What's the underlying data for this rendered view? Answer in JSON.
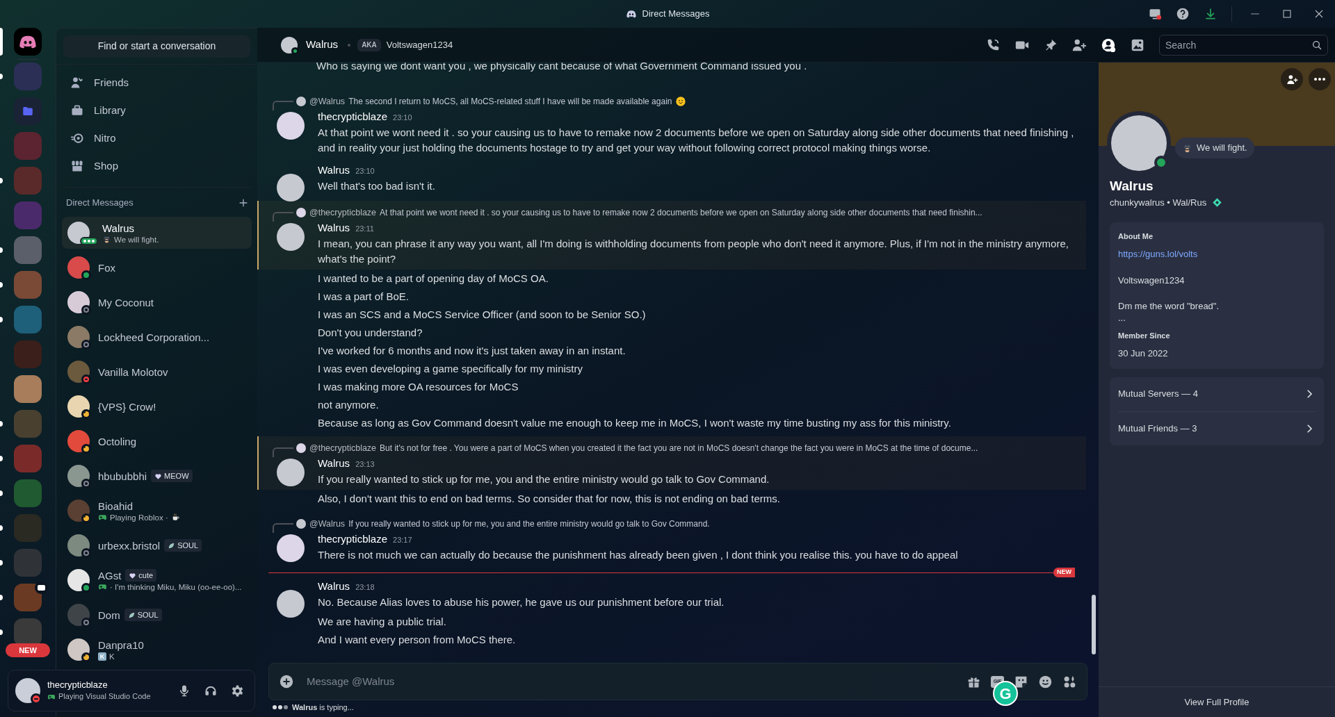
{
  "title_bar": {
    "title": "Direct Messages"
  },
  "servers": [
    {
      "kind": "home",
      "selected": true,
      "unread": false,
      "streaming": false
    },
    {
      "kind": "server",
      "selected": false,
      "unread": true,
      "streaming": false
    },
    {
      "kind": "folder",
      "selected": false,
      "unread": false,
      "streaming": false
    },
    {
      "kind": "server",
      "selected": false,
      "unread": false,
      "streaming": false
    },
    {
      "kind": "server",
      "selected": false,
      "unread": true,
      "streaming": false
    },
    {
      "kind": "server",
      "selected": false,
      "unread": false,
      "streaming": false
    },
    {
      "kind": "server",
      "selected": false,
      "unread": true,
      "streaming": false
    },
    {
      "kind": "server",
      "selected": false,
      "unread": true,
      "streaming": false
    },
    {
      "kind": "server",
      "selected": false,
      "unread": true,
      "streaming": false
    },
    {
      "kind": "server",
      "selected": false,
      "unread": false,
      "streaming": false
    },
    {
      "kind": "server",
      "selected": false,
      "unread": false,
      "streaming": false
    },
    {
      "kind": "server",
      "selected": false,
      "unread": true,
      "streaming": false
    },
    {
      "kind": "server",
      "selected": false,
      "unread": true,
      "streaming": false
    },
    {
      "kind": "server",
      "selected": false,
      "unread": true,
      "streaming": false
    },
    {
      "kind": "server",
      "selected": false,
      "unread": true,
      "streaming": false
    },
    {
      "kind": "server",
      "selected": false,
      "unread": true,
      "streaming": false
    },
    {
      "kind": "server",
      "selected": false,
      "unread": true,
      "streaming": true
    },
    {
      "kind": "server",
      "selected": false,
      "unread": true,
      "streaming": false
    }
  ],
  "new_badge": "NEW",
  "sidebar": {
    "search": "Find or start a conversation",
    "nav": [
      {
        "kind": "friends",
        "label": "Friends"
      },
      {
        "kind": "library",
        "label": "Library"
      },
      {
        "kind": "nitro",
        "label": "Nitro"
      },
      {
        "kind": "shop",
        "label": "Shop"
      }
    ],
    "dm_heading": "Direct Messages",
    "dms": [
      {
        "name": "Walrus",
        "color": "#23a55a",
        "selected": true,
        "typing": true,
        "activity": {
          "kind": "custom",
          "text": "We will fight."
        }
      },
      {
        "name": "Fox",
        "color": "#23a55a",
        "selected": false,
        "typing": false
      },
      {
        "name": "My Coconut",
        "color": "#80848e",
        "selected": false,
        "typing": false
      },
      {
        "name": "Lockheed Corporation...",
        "color": "#80848e",
        "selected": false,
        "typing": false
      },
      {
        "name": "Vanilla Molotov",
        "color": "#f23f43",
        "selected": false,
        "typing": false
      },
      {
        "name": "{VPS} Crow!",
        "color": "#f0b232",
        "selected": false,
        "typing": false
      },
      {
        "name": "Octoling",
        "color": "#f0b232",
        "selected": false,
        "typing": false
      },
      {
        "name": "hbububbhi",
        "color": "#80848e",
        "selected": false,
        "typing": false,
        "tag": {
          "kind": "heart",
          "label": "MEOW"
        }
      },
      {
        "name": "Bioahid",
        "color": "#f0b232",
        "selected": false,
        "typing": false,
        "activity": {
          "kind": "game_emoji",
          "text": "Playing Roblox ·"
        }
      },
      {
        "name": "urbexx.bristol",
        "color": "#80848e",
        "selected": false,
        "typing": false,
        "tag": {
          "kind": "leaf",
          "label": "SOUL"
        }
      },
      {
        "name": "AGst",
        "color": "#23a55a",
        "selected": false,
        "typing": false,
        "tag": {
          "kind": "heart",
          "label": "cute"
        },
        "activity": {
          "kind": "game",
          "text": "· I'm thinking Miku, Miku (oo-ee-oo)..."
        }
      },
      {
        "name": "Dom",
        "color": "#80848e",
        "selected": false,
        "typing": false,
        "tag": {
          "kind": "leaf",
          "label": "SOUL"
        }
      },
      {
        "name": "Danpra10",
        "color": "#f0b232",
        "selected": false,
        "typing": false,
        "activity": {
          "kind": "tile",
          "tile": "K",
          "text": "K"
        }
      }
    ]
  },
  "user_panel": {
    "name": "thecrypticblaze",
    "activity": "Playing Visual Studio Code",
    "color": "#f23f43"
  },
  "header": {
    "name": "Walrus",
    "color": "#23a55a",
    "aka": "AKA",
    "alias": "Voltswagen1234",
    "search": {
      "placeholder": "Search"
    }
  },
  "messages": [
    {
      "kind": "continuation",
      "lines": [
        "Who is saying we dont want you , we physically cant because of what Government Command issued you ."
      ]
    },
    {
      "kind": "message",
      "author": "thecrypticblaze",
      "time": "23:10",
      "mentioned": false,
      "reply": {
        "author": "@Walrus",
        "text": "The second I return to MoCS, all MoCS-related stuff I have will be made available again",
        "emoji": true
      },
      "lines": [
        "At that point we wont need it . so your causing us to have to remake now 2 documents before we open on Saturday along side other documents that need finishing , and in reality your just holding the documents hostage to try and get your way without following correct protocol making things worse."
      ]
    },
    {
      "kind": "message",
      "author": "Walrus",
      "time": "23:10",
      "mentioned": false,
      "lines": [
        "Well that's too bad isn't it."
      ]
    },
    {
      "kind": "message",
      "author": "Walrus",
      "time": "23:11",
      "mentioned": true,
      "reply": {
        "author": "@thecrypticblaze",
        "text": "At that point we wont need it . so your causing us to have to remake now 2 documents before we open on Saturday along side other documents that need finishin..."
      },
      "lines": [
        "I mean, you can phrase it any way you want, all I'm doing is withholding documents from people who don't need it anymore. Plus, if I'm not in the ministry anymore, what's the point?",
        "I wanted to be a part of opening day of MoCS OA.",
        "I was a part of BoE.",
        "I was an SCS and a MoCS Service Officer (and soon to be Senior SO.)",
        "Don't you understand?",
        "I've worked for 6 months and now it's just taken away in an instant.",
        "I was even developing a game specifically for my ministry",
        "I was making more OA resources for MoCS",
        "not anymore.",
        "Because as long as Gov Command doesn't value me enough to keep me in MoCS, I won't waste my time busting my ass for this ministry."
      ]
    },
    {
      "kind": "message",
      "author": "Walrus",
      "time": "23:13",
      "mentioned": true,
      "reply": {
        "author": "@thecrypticblaze",
        "text": "But it's not for free . You were a part of MoCS when you created it the fact you are not in MoCS doesn't change the fact you were in MoCS at the time of docume..."
      },
      "lines": [
        "If you really wanted to stick up for me, you and the entire ministry would go talk to Gov Command.",
        "Also, I don't want this to end on bad terms. So consider that for now, this is not ending on bad terms."
      ]
    },
    {
      "kind": "message",
      "author": "thecrypticblaze",
      "time": "23:17",
      "mentioned": false,
      "reply": {
        "author": "@Walrus",
        "text": "If you really wanted to stick up for me, you and the entire ministry would go talk to Gov Command."
      },
      "lines": [
        "There is not much we can actually do because the punishment has already been given , I dont think you realise this. you have to do appeal"
      ]
    },
    {
      "kind": "divider",
      "label": "NEW"
    },
    {
      "kind": "message",
      "author": "Walrus",
      "time": "23:18",
      "mentioned": false,
      "lines": [
        "No. Because Alias loves to abuse his power, he gave us our punishment before our trial.",
        "We are having a public trial.",
        "And I want every person from MoCS there."
      ]
    }
  ],
  "composer": {
    "placeholder": "Message @Walrus",
    "gif": "GIF",
    "overlay_badge": "G"
  },
  "typing": "**Walrus** is typing...",
  "profile": {
    "color": "#23a55a",
    "status_text": "We will fight.",
    "name": "Walrus",
    "handle": "chunkywalrus • Wal/Rus",
    "about_heading": "About Me",
    "about_link": "https://guns.lol/volts",
    "about_lines": [
      "Voltswagen1234",
      "Dm me the word \"bread\".",
      "..."
    ],
    "member_heading": "Member Since",
    "member_since": "30 Jun 2022",
    "mutuals": [
      "Mutual Servers — 4",
      "Mutual Friends — 3"
    ],
    "view_full": "View Full Profile"
  }
}
